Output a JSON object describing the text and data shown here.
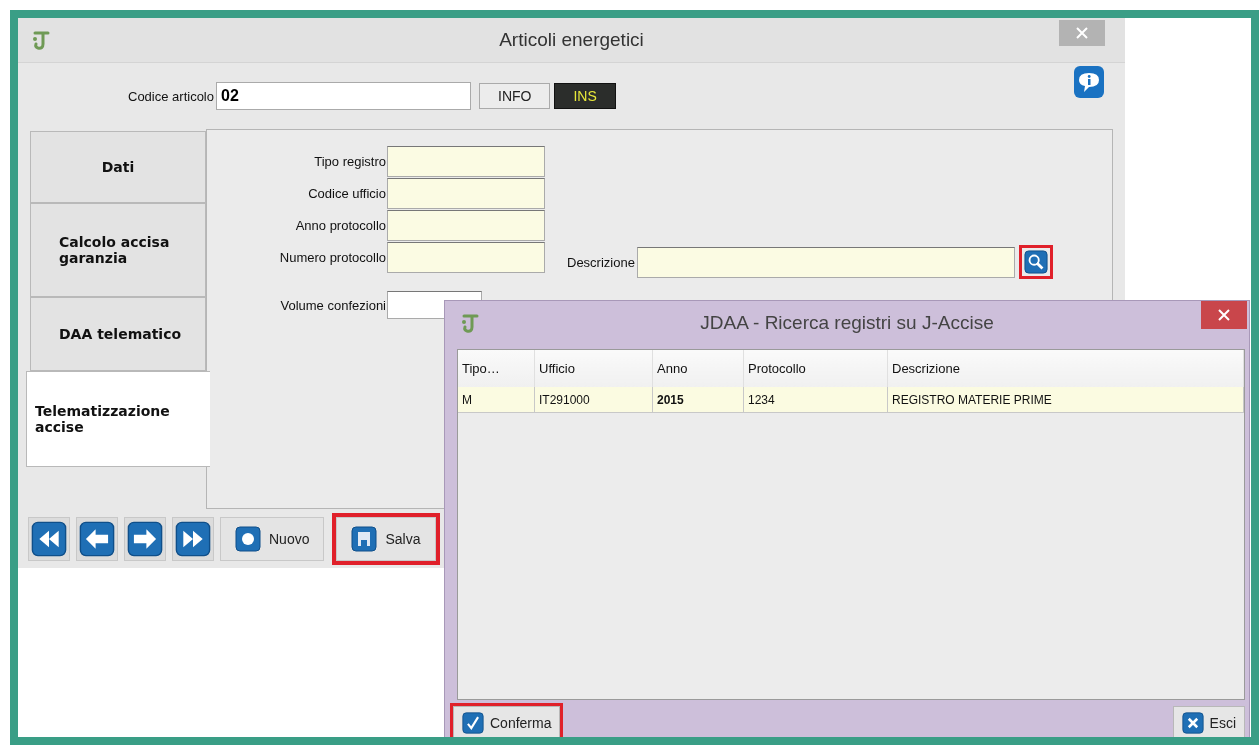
{
  "main_window": {
    "title": "Articoli energetici",
    "code_label": "Codice articolo",
    "code_value": "02",
    "mode_buttons": [
      {
        "label": "INFO",
        "active": false
      },
      {
        "label": "INS",
        "active": true
      }
    ],
    "tabs": [
      {
        "label": "Dati",
        "selected": false
      },
      {
        "label": "Calcolo accisa garanzia",
        "selected": false
      },
      {
        "label": "DAA telematico",
        "selected": false
      },
      {
        "label": "Telematizzazione accise",
        "selected": true
      }
    ],
    "fields": [
      {
        "label": "Tipo registro"
      },
      {
        "label": "Codice ufficio"
      },
      {
        "label": "Anno protocollo"
      },
      {
        "label": "Numero protocollo"
      }
    ],
    "description_field": {
      "label": "Descrizione",
      "search_highlighted": true
    },
    "volume_field": {
      "label": "Volume confezioni"
    },
    "toolbar": [
      {
        "kind": "first"
      },
      {
        "kind": "previous"
      },
      {
        "kind": "next"
      },
      {
        "kind": "last"
      },
      {
        "kind": "new",
        "label": "Nuovo",
        "highlighted": false
      },
      {
        "kind": "save",
        "label": "Salva",
        "highlighted": true
      }
    ]
  },
  "dialog": {
    "title": "JDAA - Ricerca registri su J-Accise",
    "columns": [
      "Tipo…",
      "Ufficio",
      "Anno",
      "Protocollo",
      "Descrizione"
    ],
    "rows": [
      {
        "cells": [
          "M",
          "IT291000",
          "2015",
          "1234",
          "REGISTRO MATERIE PRIME"
        ],
        "selected": true
      }
    ],
    "buttons": [
      {
        "kind": "confirm",
        "label": "Conferma",
        "highlighted": true
      },
      {
        "kind": "exit",
        "label": "Esci",
        "highlighted": false
      }
    ]
  }
}
